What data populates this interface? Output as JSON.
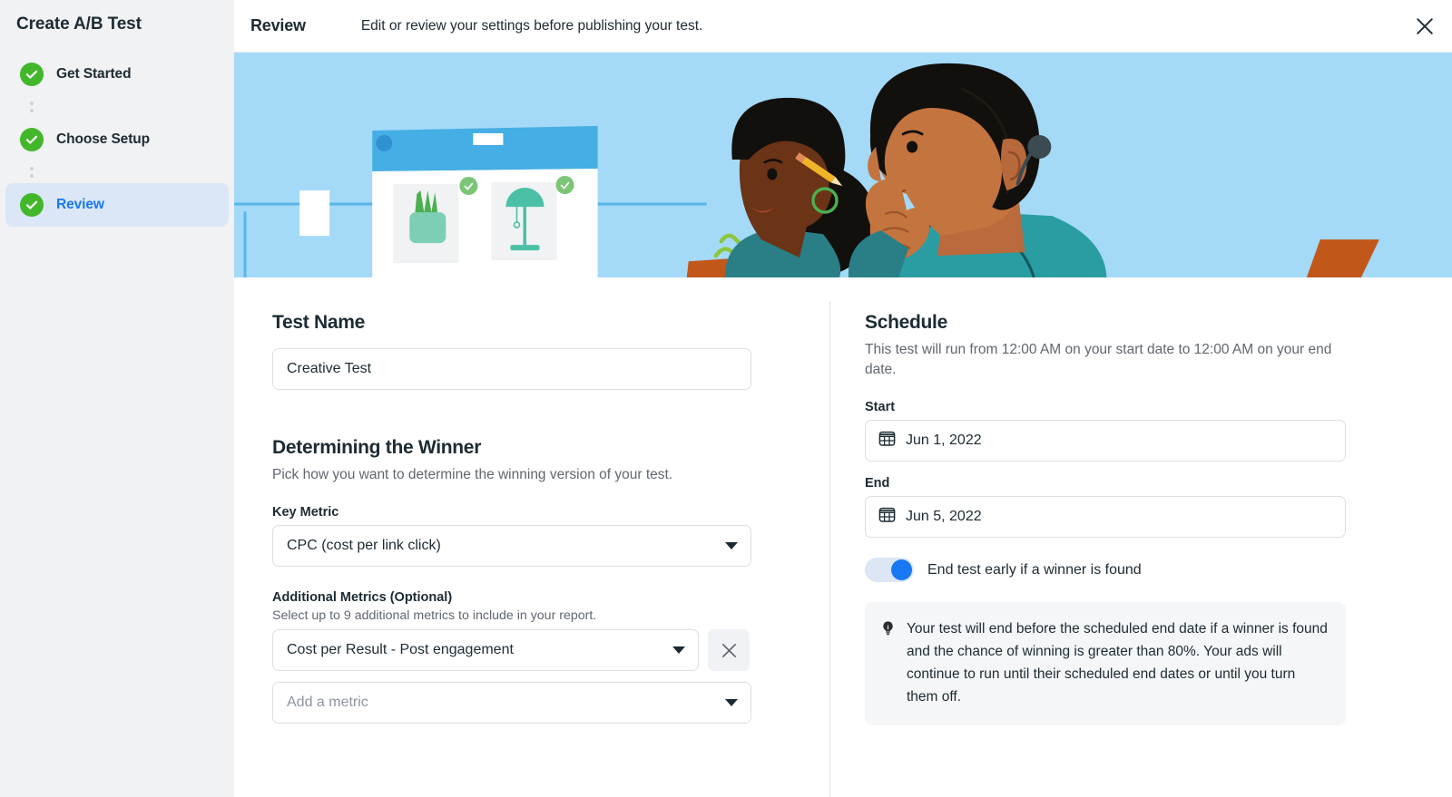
{
  "sidebar": {
    "title": "Create A/B Test",
    "steps": [
      {
        "label": "Get Started",
        "state": "complete"
      },
      {
        "label": "Choose Setup",
        "state": "complete"
      },
      {
        "label": "Review",
        "state": "current"
      }
    ]
  },
  "topbar": {
    "title": "Review",
    "subtitle": "Edit or review your settings before publishing your test.",
    "close_icon": "close-icon"
  },
  "banner": {
    "alt": "Illustration of two people reviewing two ad creatives on a screen",
    "colors": {
      "background": "#a4daf8",
      "screen_header": "#45aee4",
      "accent_green": "#67c9b0",
      "check_green": "#7cc576",
      "desk": "#c2571a"
    }
  },
  "left": {
    "test_name": {
      "heading": "Test Name",
      "value": "Creative Test"
    },
    "winner": {
      "heading": "Determining the Winner",
      "description": "Pick how you want to determine the winning version of your test.",
      "key_metric_label": "Key Metric",
      "key_metric_value": "CPC (cost per link click)",
      "additional_label": "Additional Metrics (Optional)",
      "additional_sub": "Select up to 9 additional metrics to include in your report.",
      "additional_value": "Cost per Result - Post engagement",
      "remove_icon": "close-icon",
      "add_placeholder": "Add a metric",
      "caret_icon": "chevron-down-icon"
    }
  },
  "right": {
    "schedule": {
      "heading": "Schedule",
      "description": "This test will run from 12:00 AM on your start date to 12:00 AM on your end date.",
      "start_label": "Start",
      "start_value": "Jun 1, 2022",
      "end_label": "End",
      "end_value": "Jun 5, 2022",
      "calendar_icon": "calendar-icon",
      "toggle_label": "End test early if a winner is found",
      "toggle_on": true,
      "tip_icon": "lightbulb-icon",
      "tip_text": "Your test will end before the scheduled end date if a winner is found and the chance of winning is greater than 80%. Your ads will continue to run until their scheduled end dates or until you turn them off."
    }
  },
  "colors": {
    "accent_blue": "#1877f2",
    "success_green": "#42b72a",
    "active_bg": "#dbe7f6",
    "sidebar_bg": "#f1f2f3"
  }
}
